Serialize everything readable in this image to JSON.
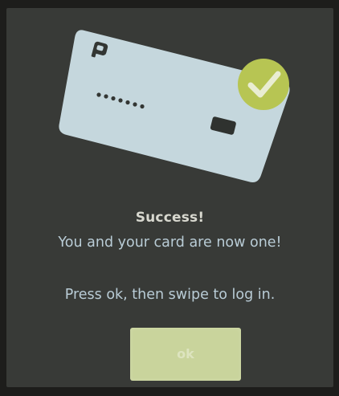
{
  "screen": {
    "title": "Success!",
    "subtitle": "You and your card are now one!",
    "instruction": "Press ok, then swipe to log in.",
    "ok_button_label": "ok"
  },
  "illustration": {
    "card_icon": "card-icon",
    "check_icon": "checkmark-icon",
    "card_color": "#c5d7dd",
    "check_badge_color": "#b7c553"
  },
  "colors": {
    "background": "#383a37",
    "text": "#b9ccd6",
    "button": "#c9d49c"
  }
}
